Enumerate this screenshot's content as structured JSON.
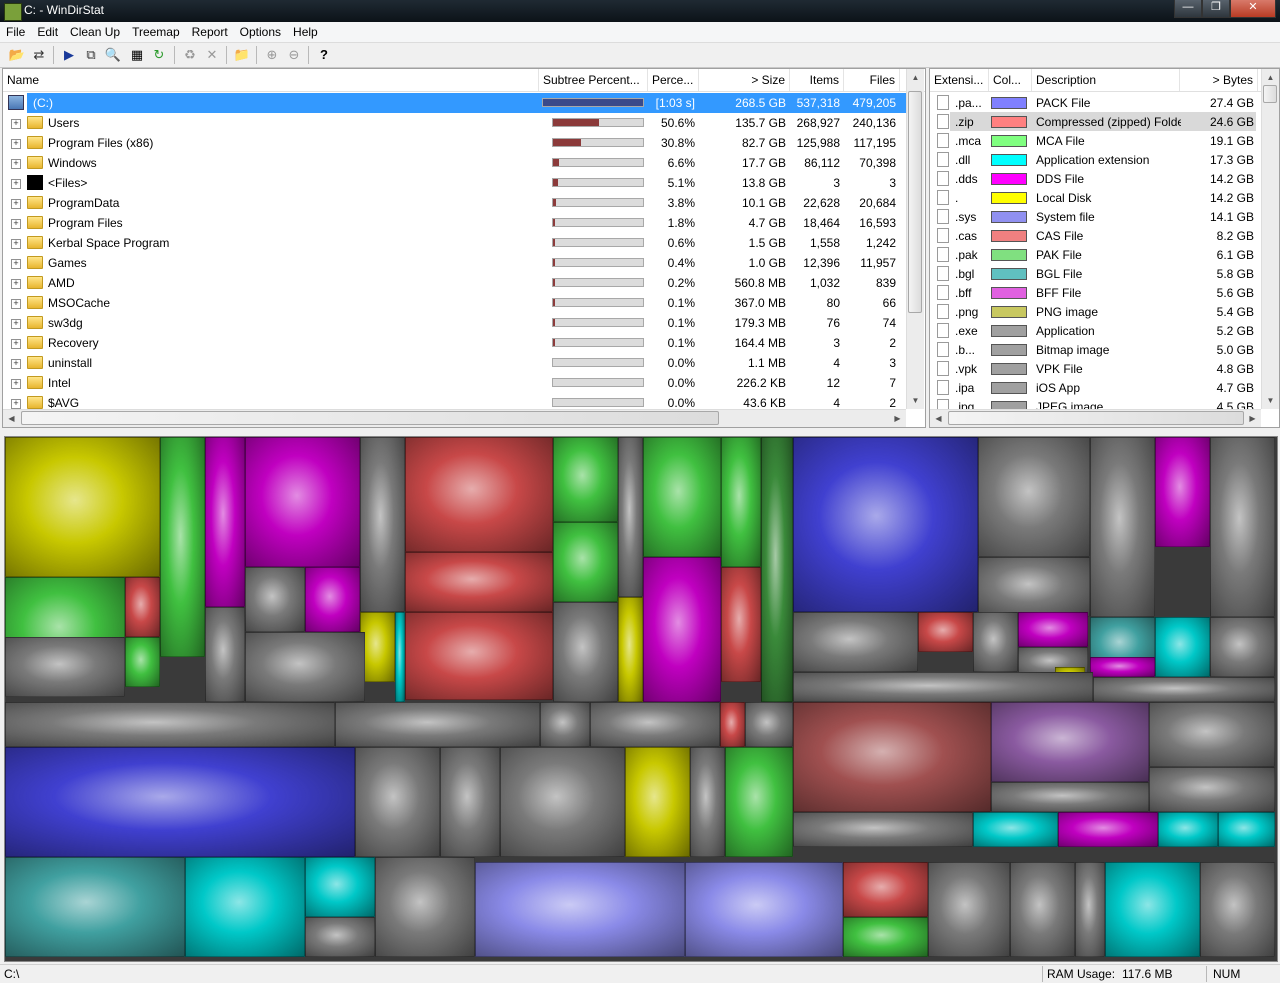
{
  "window": {
    "title": "C: - WinDirStat"
  },
  "menu": [
    "File",
    "Edit",
    "Clean Up",
    "Treemap",
    "Report",
    "Options",
    "Help"
  ],
  "toolbar_icons": [
    "open-icon",
    "refresh-icon",
    "play-icon",
    "copy-icon",
    "explorer-icon",
    "cmd-icon",
    "refresh-all-icon",
    "recycle-icon",
    "delete-icon",
    "new-folder-icon",
    "zoom-in-icon",
    "zoom-out-icon",
    "help-icon"
  ],
  "tree": {
    "columns": [
      "Name",
      "Subtree Percent...",
      "Perce...",
      "> Size",
      "Items",
      "Files"
    ],
    "root": {
      "name": "(C:)",
      "percent": "[1:03 s]",
      "size": "268.5 GB",
      "items": "537,318",
      "files": "479,205",
      "fraction": 1.0
    },
    "rows": [
      {
        "name": "Users",
        "percent": "50.6%",
        "size": "135.7 GB",
        "items": "268,927",
        "files": "240,136",
        "fraction": 0.506,
        "icon": "folder"
      },
      {
        "name": "Program Files (x86)",
        "percent": "30.8%",
        "size": "82.7 GB",
        "items": "125,988",
        "files": "117,195",
        "fraction": 0.308,
        "icon": "folder"
      },
      {
        "name": "Windows",
        "percent": "6.6%",
        "size": "17.7 GB",
        "items": "86,112",
        "files": "70,398",
        "fraction": 0.066,
        "icon": "folder"
      },
      {
        "name": "<Files>",
        "percent": "5.1%",
        "size": "13.8 GB",
        "items": "3",
        "files": "3",
        "fraction": 0.051,
        "icon": "files"
      },
      {
        "name": "ProgramData",
        "percent": "3.8%",
        "size": "10.1 GB",
        "items": "22,628",
        "files": "20,684",
        "fraction": 0.038,
        "icon": "folder"
      },
      {
        "name": "Program Files",
        "percent": "1.8%",
        "size": "4.7 GB",
        "items": "18,464",
        "files": "16,593",
        "fraction": 0.018,
        "icon": "folder"
      },
      {
        "name": "Kerbal Space Program",
        "percent": "0.6%",
        "size": "1.5 GB",
        "items": "1,558",
        "files": "1,242",
        "fraction": 0.006,
        "icon": "folder"
      },
      {
        "name": "Games",
        "percent": "0.4%",
        "size": "1.0 GB",
        "items": "12,396",
        "files": "11,957",
        "fraction": 0.004,
        "icon": "folder"
      },
      {
        "name": "AMD",
        "percent": "0.2%",
        "size": "560.8 MB",
        "items": "1,032",
        "files": "839",
        "fraction": 0.002,
        "icon": "folder"
      },
      {
        "name": "MSOCache",
        "percent": "0.1%",
        "size": "367.0 MB",
        "items": "80",
        "files": "66",
        "fraction": 0.001,
        "icon": "folder"
      },
      {
        "name": "sw3dg",
        "percent": "0.1%",
        "size": "179.3 MB",
        "items": "76",
        "files": "74",
        "fraction": 0.001,
        "icon": "folder"
      },
      {
        "name": "Recovery",
        "percent": "0.1%",
        "size": "164.4 MB",
        "items": "3",
        "files": "2",
        "fraction": 0.001,
        "icon": "folder"
      },
      {
        "name": "uninstall",
        "percent": "0.0%",
        "size": "1.1 MB",
        "items": "4",
        "files": "3",
        "fraction": 0.0,
        "icon": "folder"
      },
      {
        "name": "Intel",
        "percent": "0.0%",
        "size": "226.2 KB",
        "items": "12",
        "files": "7",
        "fraction": 0.0,
        "icon": "folder"
      },
      {
        "name": "$AVG",
        "percent": "0.0%",
        "size": "43.6 KB",
        "items": "4",
        "files": "2",
        "fraction": 0.0,
        "icon": "folder"
      }
    ]
  },
  "extensions": {
    "columns": [
      "Extensi...",
      "Col...",
      "Description",
      "> Bytes"
    ],
    "rows": [
      {
        "ext": ".pa...",
        "color": "#8080ff",
        "desc": "PACK File",
        "bytes": "27.4 GB"
      },
      {
        "ext": ".zip",
        "color": "#ff8080",
        "desc": "Compressed (zipped) Folder",
        "bytes": "24.6 GB",
        "selected": true
      },
      {
        "ext": ".mca",
        "color": "#80ff80",
        "desc": "MCA File",
        "bytes": "19.1 GB"
      },
      {
        "ext": ".dll",
        "color": "#00ffff",
        "desc": "Application extension",
        "bytes": "17.3 GB"
      },
      {
        "ext": ".dds",
        "color": "#ff00ff",
        "desc": "DDS File",
        "bytes": "14.2 GB"
      },
      {
        "ext": ".",
        "color": "#ffff00",
        "desc": "Local Disk",
        "bytes": "14.2 GB"
      },
      {
        "ext": ".sys",
        "color": "#9090f0",
        "desc": "System file",
        "bytes": "14.1 GB"
      },
      {
        "ext": ".cas",
        "color": "#f08080",
        "desc": "CAS File",
        "bytes": "8.2 GB"
      },
      {
        "ext": ".pak",
        "color": "#80e080",
        "desc": "PAK File",
        "bytes": "6.1 GB"
      },
      {
        "ext": ".bgl",
        "color": "#60c0c0",
        "desc": "BGL File",
        "bytes": "5.8 GB"
      },
      {
        "ext": ".bff",
        "color": "#e060e0",
        "desc": "BFF File",
        "bytes": "5.6 GB"
      },
      {
        "ext": ".png",
        "color": "#c8c860",
        "desc": "PNG image",
        "bytes": "5.4 GB"
      },
      {
        "ext": ".exe",
        "color": "#a0a0a0",
        "desc": "Application",
        "bytes": "5.2 GB"
      },
      {
        "ext": ".b...",
        "color": "#a0a0a0",
        "desc": "Bitmap image",
        "bytes": "5.0 GB"
      },
      {
        "ext": ".vpk",
        "color": "#a0a0a0",
        "desc": "VPK File",
        "bytes": "4.8 GB"
      },
      {
        "ext": ".ipa",
        "color": "#a0a0a0",
        "desc": "iOS App",
        "bytes": "4.7 GB"
      },
      {
        "ext": ".jpg",
        "color": "#a0a0a0",
        "desc": "JPEG image",
        "bytes": "4.5 GB"
      }
    ]
  },
  "status": {
    "path": "C:\\",
    "ram_label": "RAM Usage:",
    "ram_value": "117.6 MB",
    "num": "NUM"
  },
  "colors": {
    "selection": "#3399ff",
    "root_bar": "#3a4a8a",
    "folder_bar": "#8b3a3a"
  }
}
